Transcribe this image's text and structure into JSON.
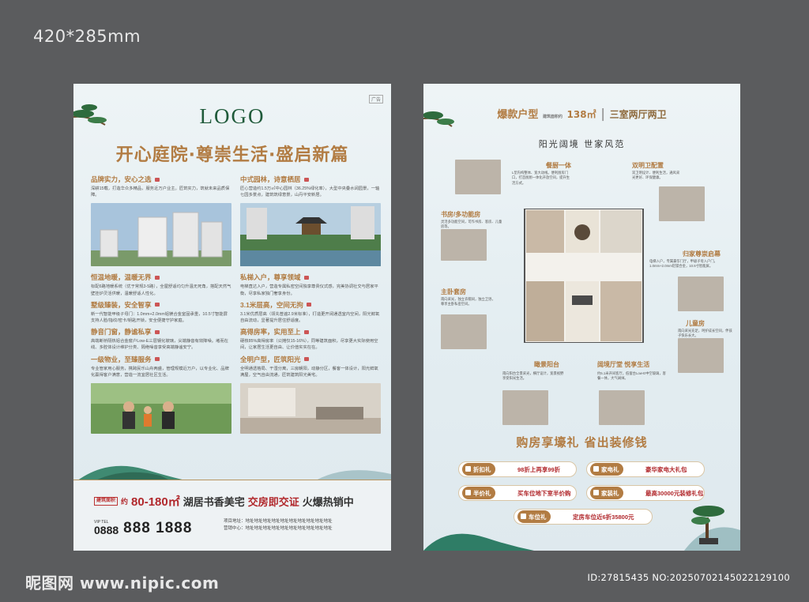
{
  "canvas": {
    "size_label": "420*285mm"
  },
  "left_sheet": {
    "logo": "LOGO",
    "ad_tag": "广告",
    "headline": "开心庭院·尊崇生活·盛启新篇",
    "left_column": [
      {
        "title": "品牌实力，安心之选",
        "text": "深耕15载，打造华众多精品，服务近万户业主。匠筑实力，筑就未来品质保障。"
      },
      {
        "title": "恒温地暖，温暖无界",
        "text": "标配6路地暖系统（优于常规3-5路），全屋舒适均匀升温无死角，搭配天然气壁挂炉灵活供暖，温暖舒适人性化。"
      },
      {
        "title": "墅级臻装，安全智享",
        "text": "新一代智能甲级子母门：1.0mm+2.0mm铝镁合金室固承重，10.5寸智能屏支持人脸/指纹/密卡/钥匙开锁，安全便捷守护家庭。"
      },
      {
        "title": "静音门窗，静谧私享",
        "text": "高端断桥隔热铝合金窗户Low-E三层钢化玻璃，尖端静音有效降噪。堵而在线、多腔体设计维护分类、隔绝噪音享受高端静谧安宁。"
      },
      {
        "title": "一级物业，至臻服务",
        "text": "专业管家用心服务，携跨民乐山舟两盛，管理规模近万户，以专业化、品牌化赢得客户满意，营造一流宜居社区生活。"
      }
    ],
    "right_column": [
      {
        "title": "中式园林，诗意栖居",
        "text": "匠心营造约1.5万㎡中心园林（36.25%绿化率），大型中央叠水阔园景，一轴七园多景点，建筑筑绿意景，山丹平安新居。"
      },
      {
        "title": "私梯入户，尊享领域",
        "text": "电梯直达入户，营造专属私密空间独享尊贵仪式感，完美协调社交与居家平衡，尽享私家独门奢享身份。"
      },
      {
        "title": "3.1米层高，空间无拘",
        "text": "3.1米优质层高（领先普遍2.9米标准），打造更开阔通透室内空间，阳光鲜氧自由流动，显著提升居住舒适度。"
      },
      {
        "title": "高得房率，实用至上",
        "text": "硬核85%高得房率（公摊仅15-16%），同等建筑面积，尽享更大实际使用空间，让家居生活更自由、让价值实实在在。"
      },
      {
        "title": "全明户型，匠筑阳光",
        "text": "全明通透格局、干湿分离，三房朝阳，动静分区，餐客一体设计，阳光鲜氧满屋，空气自由流通，匠筑建筑阳光美宅。"
      }
    ],
    "price_bar": {
      "badge": "建筑面积",
      "circle": "约",
      "area": "80-180㎡",
      "desc": "湖居书香美宅",
      "deliver": "交房即交证",
      "hot": "火爆热销中",
      "vip": "VIP TEL",
      "tel_prefix": "0888",
      "tel": "888 1888",
      "address_lines": [
        "项目地址：地址地址地址地址地址地址地址地址地址地址",
        "营销中心：地址地址地址地址地址地址地址地址地址地址"
      ]
    }
  },
  "right_sheet": {
    "header": {
      "a": "爆款户型",
      "b_prefix": "建筑面积约",
      "b": "138㎡",
      "c": "三室两厅两卫"
    },
    "subtitle": "阳光阔境 世家风范",
    "features": [
      {
        "key": "dining",
        "title": "餐厨一体",
        "text": "L型内构整体、宽大动线。便利厨房门口，打造厨厨一体化开放空间，提升生活方式。"
      },
      {
        "key": "bath",
        "title": "双明卫配置",
        "text": "双卫明设计、便利生活，通风采光更好、环保健康。"
      },
      {
        "key": "study",
        "title": "书房/多功能房",
        "text": "灵活多功能空间，可作书房、客房、儿童房等。"
      },
      {
        "key": "entry",
        "title": "归家尊崇启幕",
        "text": "电梯入户，专属豪华门厅，甲级子母入户门，1.0mm+2.0mm铝镁合金，10.5寸智能屏。"
      },
      {
        "key": "master",
        "title": "主卧套房",
        "text": "南向采光，独立衣帽间，独立卫浴，尊享主卧私密空间。"
      },
      {
        "key": "kids",
        "title": "儿童房",
        "text": "南向采光充足，呵护成长空间，伴孩子快乐长大。"
      },
      {
        "key": "balcony",
        "title": "瞰景阳台",
        "text": "南向阳台全景采光，横厅设计，宽景视野享受阳光生活。"
      },
      {
        "key": "living",
        "title": "阔境厅堂 悦享生活",
        "text": "约5.1米开间客厅，低窗台Low-E中空玻璃，客餐一体，大气阔绰。"
      }
    ],
    "gift_title": "购房享壕礼  省出装修钱",
    "gifts": [
      {
        "tag": "折扣礼",
        "value": "98折上再享99折"
      },
      {
        "tag": "家电礼",
        "value": "豪华家电大礼包"
      },
      {
        "tag": "半价礼",
        "value": "买车位地下室半价购"
      },
      {
        "tag": "家装礼",
        "value": "最高30000元装修礼包"
      },
      {
        "tag": "车位礼",
        "value": "定房车位近6折35800元"
      }
    ]
  },
  "watermark": {
    "left": "昵图网 www.nipic.com",
    "right": "ID:27815435 NO:20250702145022129100"
  },
  "colors": {
    "gold": "#b27c43",
    "red": "#b1282c",
    "ink": "#1f5a3a",
    "bg": "#5b5c5e"
  }
}
